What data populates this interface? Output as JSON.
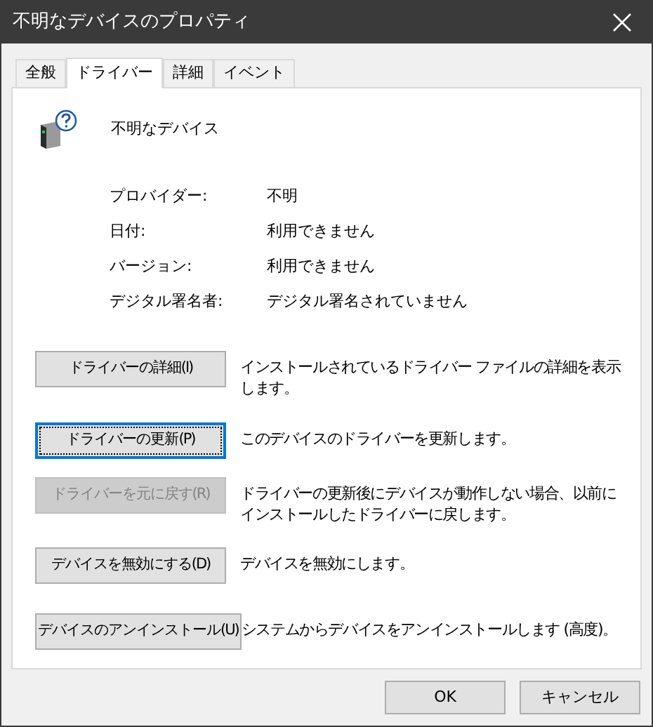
{
  "window": {
    "title": "不明なデバイスのプロパティ"
  },
  "tabs": [
    {
      "label": "全般",
      "selected": false
    },
    {
      "label": "ドライバー",
      "selected": true
    },
    {
      "label": "詳細",
      "selected": false
    },
    {
      "label": "イベント",
      "selected": false
    }
  ],
  "device": {
    "name": "不明なデバイス"
  },
  "properties": [
    {
      "label": "プロバイダー:",
      "value": "不明"
    },
    {
      "label": "日付:",
      "value": "利用できません"
    },
    {
      "label": "バージョン:",
      "value": "利用できません"
    },
    {
      "label": "デジタル署名者:",
      "value": "デジタル署名されていません"
    }
  ],
  "actions": [
    {
      "button": "ドライバーの詳細(I)",
      "description": "インストールされているドライバー ファイルの詳細を表示します。",
      "disabled": false,
      "focused": false
    },
    {
      "button": "ドライバーの更新(P)",
      "description": "このデバイスのドライバーを更新します。",
      "disabled": false,
      "focused": true
    },
    {
      "button": "ドライバーを元に戻す(R)",
      "description": "ドライバーの更新後にデバイスが動作しない場合、以前にインストールしたドライバーに戻します。",
      "disabled": true,
      "focused": false
    },
    {
      "button": "デバイスを無効にする(D)",
      "description": "デバイスを無効にします。",
      "disabled": false,
      "focused": false
    },
    {
      "button": "デバイスのアンインストール(U)",
      "description": "システムからデバイスをアンインストールします (高度)。",
      "disabled": false,
      "focused": false
    }
  ],
  "buttons": [
    "OK",
    "キャンセル"
  ]
}
